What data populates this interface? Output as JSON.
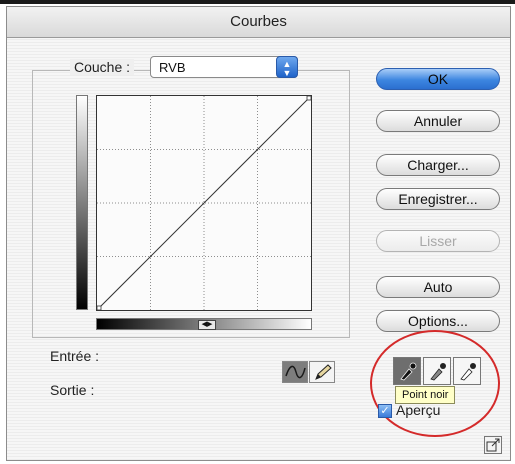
{
  "dialog": {
    "title": "Courbes"
  },
  "couche": {
    "label": "Couche :",
    "value": "RVB"
  },
  "labels": {
    "entree": "Entrée :",
    "sortie": "Sortie :"
  },
  "buttons": {
    "ok": "OK",
    "annuler": "Annuler",
    "charger": "Charger...",
    "enregistrer": "Enregistrer...",
    "lisser": "Lisser",
    "auto": "Auto",
    "options": "Options..."
  },
  "tooltip": "Point noir",
  "preview": {
    "label": "Aperçu",
    "checked": true
  },
  "icons": {
    "curve_tool": "curve-point-tool-icon",
    "pencil_tool": "pencil-tool-icon",
    "black_eyedropper": "eyedropper-black-icon",
    "gray_eyedropper": "eyedropper-gray-icon",
    "white_eyedropper": "eyedropper-white-icon",
    "swap_gradient": "swap-arrows-icon",
    "expand": "expand-window-icon"
  },
  "colors": {
    "accent": "#2b6fd0",
    "annotation_circle": "#d42a2a",
    "tooltip_bg": "#ffffc8"
  }
}
